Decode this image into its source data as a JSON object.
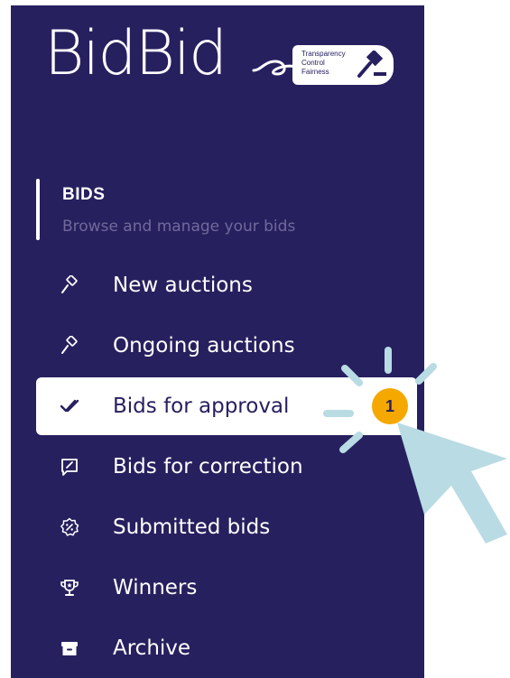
{
  "logo": {
    "wordmark": "BidBid",
    "tagline": [
      "Transparency",
      "Control",
      "Fairness"
    ]
  },
  "section": {
    "title": "BIDS",
    "subtitle": "Browse and manage your bids"
  },
  "menu": [
    {
      "label": "New auctions",
      "icon": "gavel-icon"
    },
    {
      "label": "Ongoing auctions",
      "icon": "gavel-icon"
    },
    {
      "label": "Bids for approval",
      "icon": "double-check-icon",
      "badge": "1",
      "active": true
    },
    {
      "label": "Bids for correction",
      "icon": "edit-chat-icon"
    },
    {
      "label": "Submitted bids",
      "icon": "percent-badge-icon"
    },
    {
      "label": "Winners",
      "icon": "trophy-icon"
    },
    {
      "label": "Archive",
      "icon": "archive-box-icon"
    }
  ],
  "colors": {
    "sidebar": "#27205f",
    "active_bg": "#ffffff",
    "badge": "#f5a800",
    "subtitle": "#6f6a9a",
    "cursor": "#b9dbe4"
  }
}
